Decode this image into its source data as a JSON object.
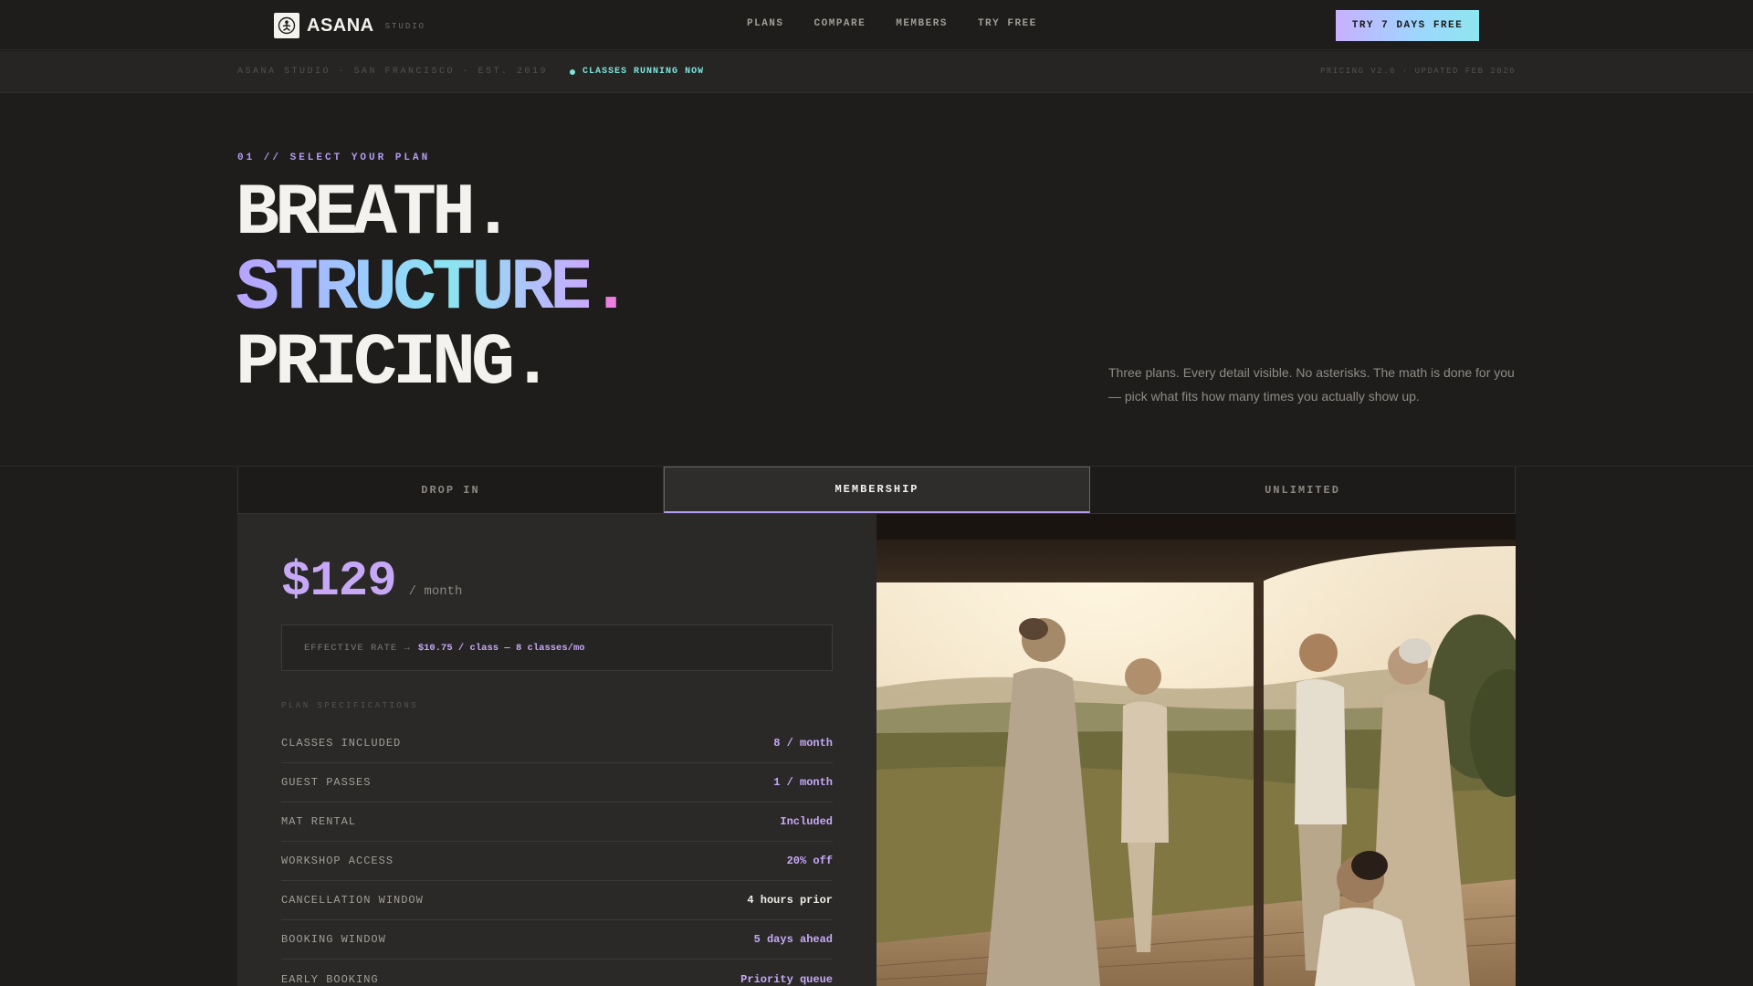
{
  "nav": {
    "brand_name": "ASANA",
    "brand_sub": "STUDIO",
    "links": [
      "PLANS",
      "COMPARE",
      "MEMBERS",
      "TRY FREE"
    ],
    "cta": "TRY 7 DAYS FREE"
  },
  "strip": {
    "location": "ASANA STUDIO · SAN FRANCISCO · EST. 2019",
    "live": "CLASSES RUNNING NOW",
    "version": "PRICING V2.6 · UPDATED FEB 2026"
  },
  "hero": {
    "eyebrow": "01 // SELECT YOUR PLAN",
    "line1": "BREATH",
    "line1_dot": ".",
    "line2": "STRUCTURE",
    "line2_dot": ".",
    "line3": "PRICING",
    "line3_dot": ".",
    "lede": "Three plans. Every detail visible. No asterisks. The math is done for you — pick what fits how many times you actually show up."
  },
  "tabs": [
    "DROP IN",
    "MEMBERSHIP",
    "UNLIMITED"
  ],
  "plan": {
    "price": "$129",
    "period": "/ month",
    "rate_label": "EFFECTIVE RATE →",
    "rate_value": "$10.75 / class — 8 classes/mo",
    "spec_heading": "PLAN SPECIFICATIONS",
    "specs": [
      {
        "label": "CLASSES INCLUDED",
        "value": "8 / month"
      },
      {
        "label": "GUEST PASSES",
        "value": "1 / month"
      },
      {
        "label": "MAT RENTAL",
        "value": "Included"
      },
      {
        "label": "WORKSHOP ACCESS",
        "value": "20% off"
      },
      {
        "label": "CANCELLATION WINDOW",
        "value": "4 hours prior"
      },
      {
        "label": "BOOKING WINDOW",
        "value": "5 days ahead"
      },
      {
        "label": "EARLY BOOKING",
        "value": "Priority queue"
      }
    ]
  },
  "colors": {
    "background": "#1e1d1c",
    "accent_purple": "#c6a8f7",
    "accent_cyan": "#7ee3dc",
    "accent_pink": "#ee7fe0"
  },
  "icons": {
    "brand": "lotus-logo-icon",
    "live": "status-dot-icon"
  }
}
